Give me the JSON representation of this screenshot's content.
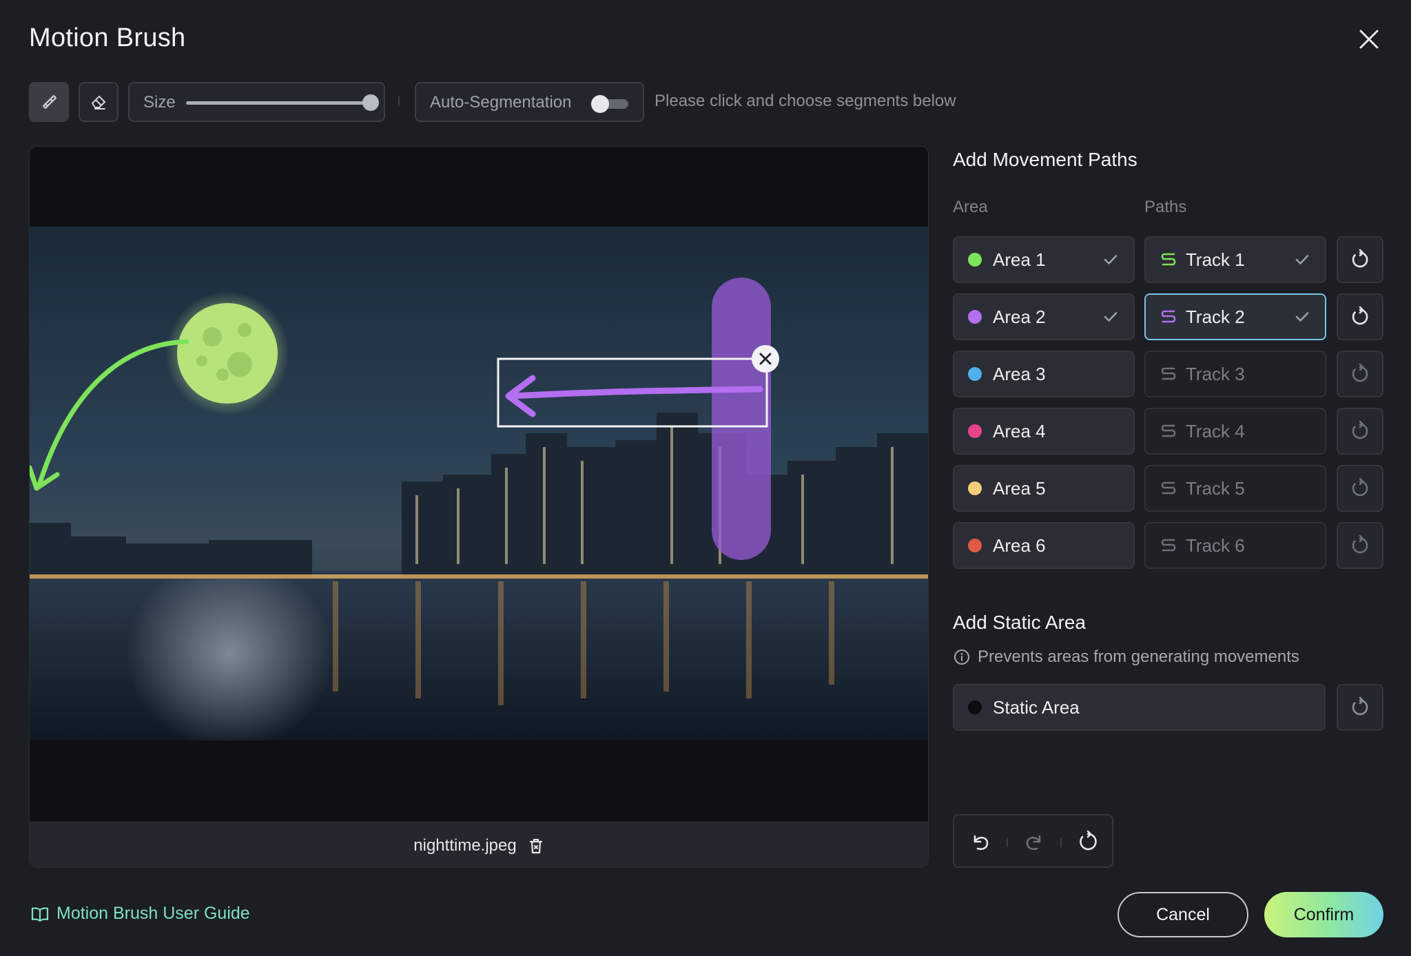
{
  "dialog": {
    "title": "Motion Brush",
    "close_icon": "close-icon"
  },
  "toolbar": {
    "brush_icon": "brush-icon",
    "eraser_icon": "eraser-icon",
    "size_label": "Size",
    "size_value": 0.95,
    "autoseg_label": "Auto-Segmentation",
    "autoseg_enabled": false,
    "hint": "Please click and choose segments below"
  },
  "canvas": {
    "file_name": "nighttime.jpeg",
    "delete_icon": "trash-icon"
  },
  "movement": {
    "title": "Add Movement Paths",
    "area_col": "Area",
    "paths_col": "Paths",
    "rows": [
      {
        "area": "Area 1",
        "area_color": "#7ee35a",
        "area_done": true,
        "track": "Track 1",
        "track_color": "#7ee35a",
        "track_done": true,
        "active": true,
        "selected": false
      },
      {
        "area": "Area 2",
        "area_color": "#b46ef0",
        "area_done": true,
        "track": "Track 2",
        "track_color": "#b46ef0",
        "track_done": true,
        "active": true,
        "selected": true
      },
      {
        "area": "Area 3",
        "area_color": "#4fb2ee",
        "area_done": false,
        "track": "Track 3",
        "track_color": "#6c7078",
        "track_done": false,
        "active": false,
        "selected": false
      },
      {
        "area": "Area 4",
        "area_color": "#e6448b",
        "area_done": false,
        "track": "Track 4",
        "track_color": "#6c7078",
        "track_done": false,
        "active": false,
        "selected": false
      },
      {
        "area": "Area 5",
        "area_color": "#f3cd78",
        "area_done": false,
        "track": "Track 5",
        "track_color": "#6c7078",
        "track_done": false,
        "active": false,
        "selected": false
      },
      {
        "area": "Area 6",
        "area_color": "#dd5a45",
        "area_done": false,
        "track": "Track 6",
        "track_color": "#6c7078",
        "track_done": false,
        "active": false,
        "selected": false
      }
    ]
  },
  "static": {
    "title": "Add Static Area",
    "info": "Prevents areas from generating movements",
    "info_icon": "info-icon",
    "label": "Static Area",
    "dot_color": "#0b0c0e"
  },
  "history": {
    "undo_icon": "undo-icon",
    "redo_icon": "redo-icon",
    "reset_icon": "reset-icon"
  },
  "footer": {
    "guide_label": "Motion Brush User Guide",
    "guide_icon": "book-icon",
    "cancel_label": "Cancel",
    "confirm_label": "Confirm"
  },
  "colors": {
    "accent_green": "#7ee35a",
    "accent_purple": "#b46ef0",
    "selected_border": "#7cc3e9",
    "guide_link": "#7fe1c2"
  }
}
